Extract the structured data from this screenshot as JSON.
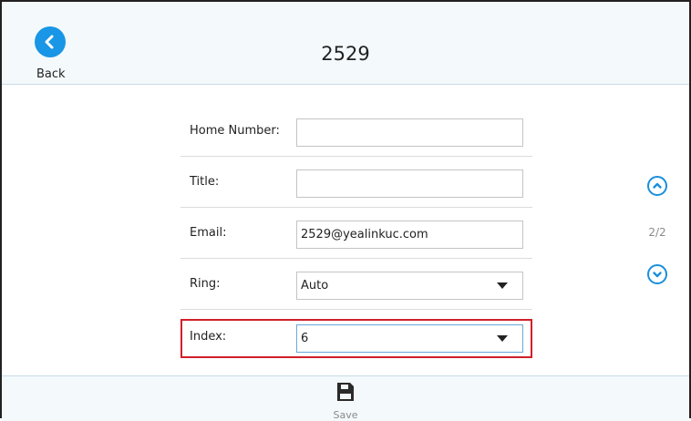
{
  "header": {
    "title": "2529",
    "back_label": "Back",
    "back_icon": "chevron-left-icon"
  },
  "form": {
    "home_number": {
      "label": "Home Number:",
      "value": ""
    },
    "title_field": {
      "label": "Title:",
      "value": ""
    },
    "email": {
      "label": "Email:",
      "value": "2529@yealinkuc.com"
    },
    "ring": {
      "label": "Ring:",
      "value": "Auto"
    },
    "index": {
      "label": "Index:",
      "value": "6"
    }
  },
  "pager": {
    "text": "2/2",
    "up_icon": "chevron-up-icon",
    "down_icon": "chevron-down-icon"
  },
  "footer": {
    "save_label": "Save",
    "save_icon": "floppy-disk-icon"
  },
  "colors": {
    "accent": "#1996e6",
    "highlight": "#d0202a",
    "panel_bg": "#f4f9fc"
  }
}
